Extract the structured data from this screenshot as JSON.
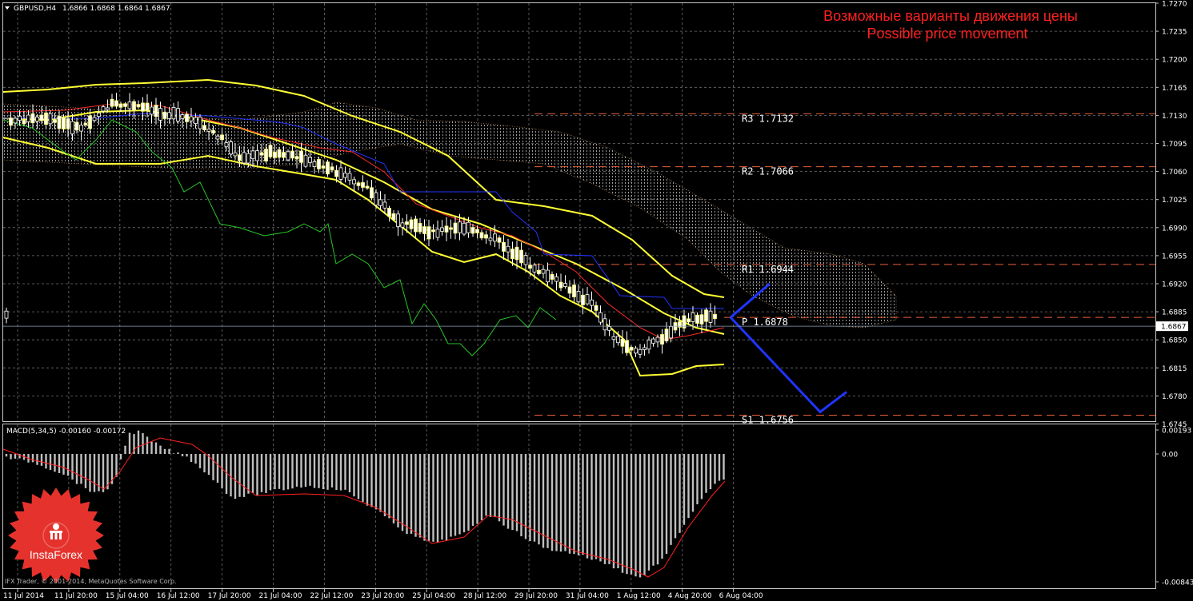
{
  "header": {
    "symbol_label": "GBPUSD,H4",
    "ohlc": "1.6866 1.6868 1.6864 1.6867"
  },
  "titles": {
    "ru": "Возможные варианты движения цены",
    "en": "Possible price movement"
  },
  "indicator": {
    "label": "MACD(5,34,5) -0.00160 -0.00172"
  },
  "footer": {
    "copyright": "IFX Trader, © 2001-2014, MetaQuotes Software Corp.",
    "brand": "InstaForex"
  },
  "colors": {
    "background": "#000000",
    "grid": "#6f6f6f",
    "candle": "#ffffff",
    "bollinger": "#ffff33",
    "tenkan": "#ff2a2a",
    "kijun": "#2233ff",
    "chikou": "#27c427",
    "cloud": "#cfcfcf",
    "pivot_lines": "#e8613a",
    "forecast": "#1f35ff",
    "macd_hist": "#c0c0c0",
    "macd_signal": "#ff2020",
    "title_text": "#ff2020",
    "logo": "#e5322d"
  },
  "chart_data": {
    "type": "candlestick",
    "symbol": "GBPUSD",
    "timeframe": "H4",
    "y_ticks": [
      "1.7270",
      "1.7235",
      "1.7200",
      "1.7165",
      "1.7130",
      "1.7095",
      "1.7060",
      "1.7025",
      "1.6990",
      "1.6955",
      "1.6920",
      "1.6885",
      "1.6850",
      "1.6815",
      "1.6780",
      "1.6745"
    ],
    "ylim": [
      1.674,
      1.727
    ],
    "x_ticks": [
      "11 Jul 2014",
      "11 Jul 20:00",
      "15 Jul 04:00",
      "16 Jul 12:00",
      "17 Jul 20:00",
      "21 Jul 04:00",
      "22 Jul 12:00",
      "23 Jul 20:00",
      "25 Jul 04:00",
      "28 Jul 12:00",
      "29 Jul 20:00",
      "31 Jul 04:00",
      "1 Aug 12:00",
      "4 Aug 20:00",
      "6 Aug 04:00"
    ],
    "current_price": "1.6867",
    "pivot_levels": [
      {
        "label": "R3",
        "value": "1.7132"
      },
      {
        "label": "R2",
        "value": "1.7066"
      },
      {
        "label": "R1",
        "value": "1.6944"
      },
      {
        "label": "P",
        "value": "1.6878"
      },
      {
        "label": "S1",
        "value": "1.6756"
      }
    ],
    "forecast_paths": [
      [
        [
          "6 Aug 04:00",
          1.6878
        ],
        [
          "6 Aug 20:00",
          1.692
        ]
      ],
      [
        [
          "6 Aug 04:00",
          1.6878
        ],
        [
          "7 Aug 20:00",
          1.676
        ],
        [
          "8 Aug 04:00",
          1.6785
        ]
      ]
    ],
    "macd": {
      "params": "5,34,5",
      "main": "-0.00160",
      "signal": "-0.00172",
      "y_ticks": [
        "0.00193",
        "0.00",
        "-0.00843"
      ]
    }
  }
}
